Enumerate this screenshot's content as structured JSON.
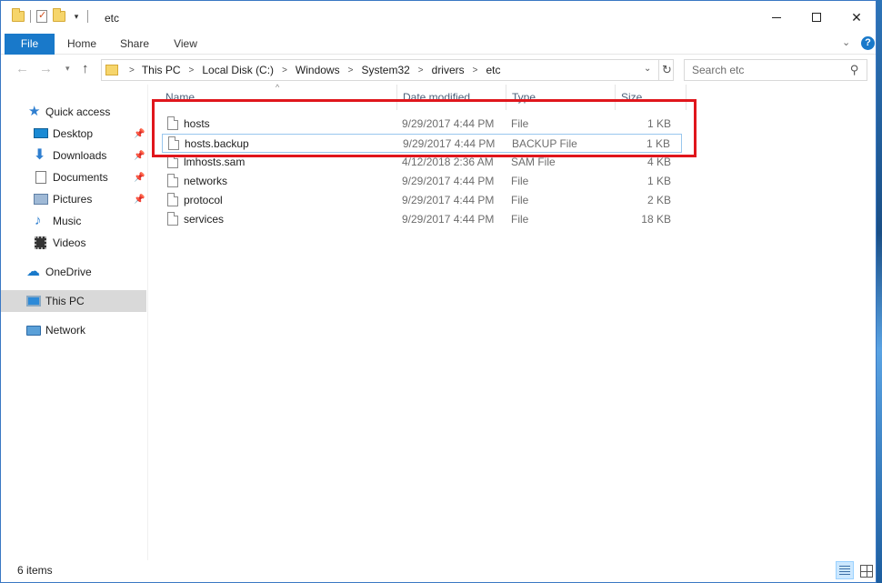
{
  "window": {
    "title": "etc",
    "controls": {
      "minimize": "minimize-icon",
      "maximize": "maximize-icon",
      "close": "close-icon"
    }
  },
  "ribbon": {
    "tabs": [
      {
        "label": "File",
        "active": true
      },
      {
        "label": "Home"
      },
      {
        "label": "Share"
      },
      {
        "label": "View"
      }
    ],
    "help_label": "?"
  },
  "navigation": {
    "breadcrumbs": [
      "This PC",
      "Local Disk (C:)",
      "Windows",
      "System32",
      "drivers",
      "etc"
    ],
    "search_placeholder": "Search etc"
  },
  "sidebar": {
    "items": [
      {
        "label": "Quick access",
        "icon": "star-icon"
      },
      {
        "label": "Desktop",
        "icon": "desktop-icon",
        "pinned": true
      },
      {
        "label": "Downloads",
        "icon": "download-icon",
        "pinned": true
      },
      {
        "label": "Documents",
        "icon": "documents-icon",
        "pinned": true
      },
      {
        "label": "Pictures",
        "icon": "pictures-icon",
        "pinned": true
      },
      {
        "label": "Music",
        "icon": "music-icon"
      },
      {
        "label": "Videos",
        "icon": "videos-icon"
      },
      {
        "label": "OneDrive",
        "icon": "cloud-icon"
      },
      {
        "label": "This PC",
        "icon": "computer-icon",
        "selected": true
      },
      {
        "label": "Network",
        "icon": "network-icon"
      }
    ]
  },
  "file_list": {
    "columns": [
      "Name",
      "Date modified",
      "Type",
      "Size"
    ],
    "rows": [
      {
        "name": "hosts",
        "date": "9/29/2017 4:44 PM",
        "type": "File",
        "size": "1 KB"
      },
      {
        "name": "hosts.backup",
        "date": "9/29/2017 4:44 PM",
        "type": "BACKUP File",
        "size": "1 KB"
      },
      {
        "name": "lmhosts.sam",
        "date": "4/12/2018 2:36 AM",
        "type": "SAM File",
        "size": "4 KB"
      },
      {
        "name": "networks",
        "date": "9/29/2017 4:44 PM",
        "type": "File",
        "size": "1 KB"
      },
      {
        "name": "protocol",
        "date": "9/29/2017 4:44 PM",
        "type": "File",
        "size": "2 KB"
      },
      {
        "name": "services",
        "date": "9/29/2017 4:44 PM",
        "type": "File",
        "size": "18 KB"
      }
    ]
  },
  "status_bar": {
    "item_count": "6 items"
  },
  "colors": {
    "accent": "#1979ca",
    "highlight_box": "#e0161c",
    "selection": "#cce8ff"
  }
}
